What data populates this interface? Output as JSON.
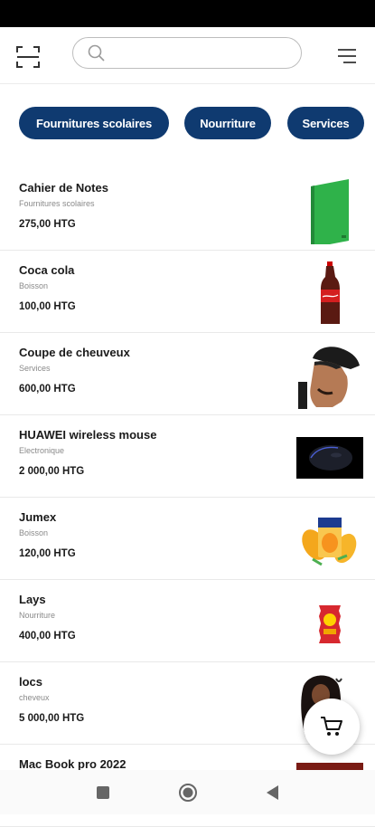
{
  "search": {
    "placeholder": ""
  },
  "chips": [
    {
      "label": "Fournitures scolaires"
    },
    {
      "label": "Nourriture"
    },
    {
      "label": "Services"
    }
  ],
  "products": [
    {
      "name": "Cahier de Notes",
      "category": "Fournitures scolaires",
      "price": "275,00 HTG",
      "image": "green-notebook"
    },
    {
      "name": "Coca cola",
      "category": "Boisson",
      "price": "100,00 HTG",
      "image": "coca-cola-bottle"
    },
    {
      "name": "Coupe de cheuveux",
      "category": "Services",
      "price": "600,00 HTG",
      "image": "haircut-man"
    },
    {
      "name": "HUAWEI wireless mouse",
      "category": "Electronique",
      "price": "2 000,00 HTG",
      "image": "black-mouse"
    },
    {
      "name": "Jumex",
      "category": "Boisson",
      "price": "120,00 HTG",
      "image": "jumex-juice"
    },
    {
      "name": "Lays",
      "category": "Nourriture",
      "price": "400,00 HTG",
      "image": "lays-chips"
    },
    {
      "name": "locs",
      "category": "cheveux",
      "price": "5 000,00 HTG",
      "image": "locs-woman"
    },
    {
      "name": "Mac Book pro 2022",
      "category": "",
      "price": "",
      "image": "macbook"
    }
  ],
  "icons": {
    "scan": "scan-icon",
    "search": "search-icon",
    "menu": "menu-icon",
    "cart": "cart-icon"
  },
  "colors": {
    "chip_bg": "#0f3a70",
    "chip_text": "#ffffff"
  }
}
